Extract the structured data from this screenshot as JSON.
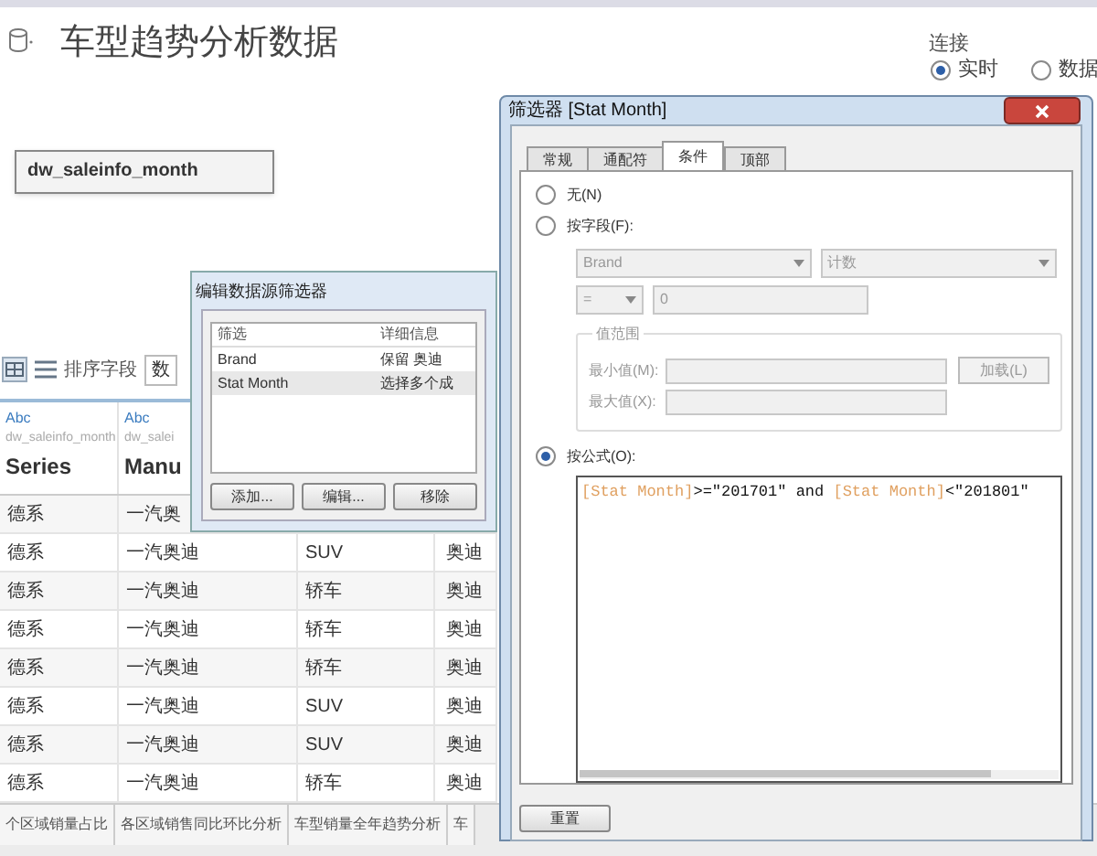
{
  "page": {
    "title": "车型趋势分析数据"
  },
  "connection": {
    "label": "连接",
    "options": [
      {
        "label": "实时",
        "selected": true
      },
      {
        "label": "数据",
        "selected": false
      }
    ]
  },
  "source": {
    "name": "dw_saleinfo_month"
  },
  "toolbar": {
    "sort_label": "排序字段",
    "sort_value": "数"
  },
  "table": {
    "columns": [
      {
        "type": "Abc",
        "source": "dw_saleinfo_month",
        "name": "Series"
      },
      {
        "type": "Abc",
        "source": "dw_salei",
        "name": "Manu"
      }
    ],
    "rows": [
      [
        "德系",
        "一汽奥"
      ],
      [
        "德系",
        "一汽奥迪",
        "SUV",
        "奥迪"
      ],
      [
        "德系",
        "一汽奥迪",
        "轿车",
        "奥迪"
      ],
      [
        "德系",
        "一汽奥迪",
        "轿车",
        "奥迪"
      ],
      [
        "德系",
        "一汽奥迪",
        "轿车",
        "奥迪"
      ],
      [
        "德系",
        "一汽奥迪",
        "SUV",
        "奥迪"
      ],
      [
        "德系",
        "一汽奥迪",
        "SUV",
        "奥迪"
      ],
      [
        "德系",
        "一汽奥迪",
        "轿车",
        "奥迪"
      ]
    ]
  },
  "sheet_tabs": [
    "个区域销量占比",
    "各区域销售同比环比分析",
    "车型销量全年趋势分析",
    "车"
  ],
  "source_filter_dialog": {
    "title": "编辑数据源筛选器",
    "columns": [
      "筛选",
      "详细信息"
    ],
    "rows": [
      {
        "filter": "Brand",
        "details": "保留 奥迪",
        "selected": false
      },
      {
        "filter": "Stat Month",
        "details": "选择多个成",
        "selected": true
      }
    ],
    "buttons": [
      "添加...",
      "编辑...",
      "移除"
    ]
  },
  "filter_dialog": {
    "title": "筛选器 [Stat Month]",
    "tabs": [
      {
        "label": "常规",
        "selected": false
      },
      {
        "label": "通配符",
        "selected": false
      },
      {
        "label": "条件",
        "selected": true
      },
      {
        "label": "顶部",
        "selected": false
      }
    ],
    "none_option": {
      "label": "无(N)",
      "selected": false
    },
    "by_field_option": {
      "label": "按字段(F):",
      "selected": false
    },
    "by_field": {
      "disabled": true,
      "field": "Brand",
      "aggregation": "计数",
      "operator": "=",
      "value": "0",
      "range_label": "值范围",
      "min_label": "最小值(M):",
      "max_label": "最大值(X):",
      "load_button": "加载(L)"
    },
    "formula_option": {
      "label": "按公式(O):",
      "selected": true
    },
    "formula": [
      {
        "kind": "field",
        "text": "[Stat Month]"
      },
      {
        "kind": "plain",
        "text": ">=\"201701\" and "
      },
      {
        "kind": "field",
        "text": "[Stat Month]"
      },
      {
        "kind": "plain",
        "text": "<\"201801\""
      }
    ],
    "reset_button": "重置"
  }
}
